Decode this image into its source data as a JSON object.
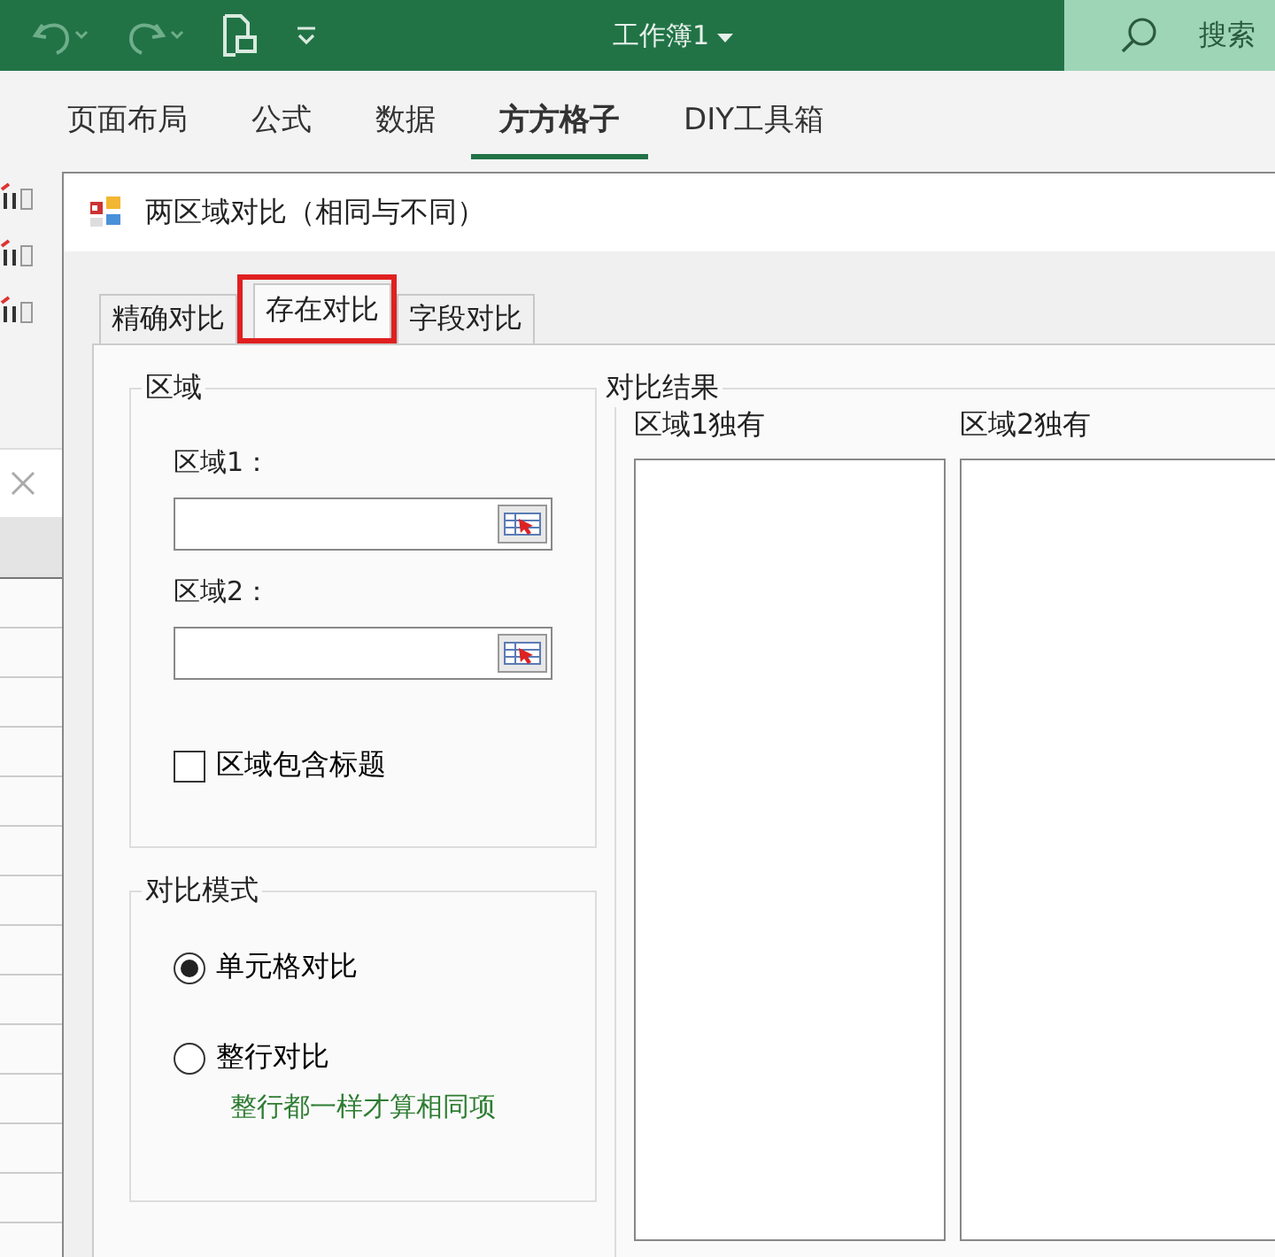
{
  "excel": {
    "title": "工作簿1",
    "search": {
      "label": "搜索"
    },
    "ribbon_tabs": [
      {
        "label": "页面布局",
        "selected": false
      },
      {
        "label": "公式",
        "selected": false
      },
      {
        "label": "数据",
        "selected": false
      },
      {
        "label": "方方格子",
        "selected": true
      },
      {
        "label": "DIY工具箱",
        "selected": false
      }
    ]
  },
  "dialog": {
    "title": "两区域对比（相同与不同）",
    "tabs": [
      {
        "label": "精确对比",
        "selected": false,
        "highlighted": false
      },
      {
        "label": "存在对比",
        "selected": true,
        "highlighted": true
      },
      {
        "label": "字段对比",
        "selected": false,
        "highlighted": false
      }
    ],
    "area_group": {
      "title": "区域",
      "fields": [
        {
          "label": "区域1："
        },
        {
          "label": "区域2："
        }
      ],
      "checkbox": {
        "label": "区域包含标题",
        "checked": false
      }
    },
    "mode_group": {
      "title": "对比模式",
      "options": [
        {
          "label": "单元格对比",
          "selected": true
        },
        {
          "label": "整行对比",
          "selected": false
        }
      ],
      "hint": "整行都一样才算相同项"
    },
    "result_group": {
      "title": "对比结果",
      "lists": [
        {
          "label": "区域1独有"
        },
        {
          "label": "区域2独有"
        }
      ]
    }
  }
}
